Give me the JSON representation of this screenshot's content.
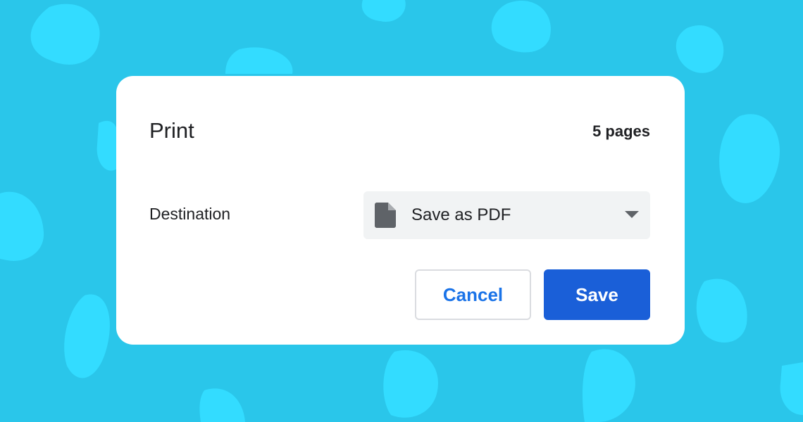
{
  "background": {
    "color": "#2ac6ea",
    "blob_color": "#33dcff"
  },
  "dialog": {
    "title": "Print",
    "page_count": "5 pages",
    "destination": {
      "label": "Destination",
      "selected": "Save as PDF",
      "icon": "file-icon"
    },
    "buttons": {
      "cancel": "Cancel",
      "save": "Save"
    }
  },
  "colors": {
    "primary": "#1a5fd8",
    "link": "#1a73e8",
    "text": "#202124",
    "select_bg": "#f1f3f4"
  }
}
